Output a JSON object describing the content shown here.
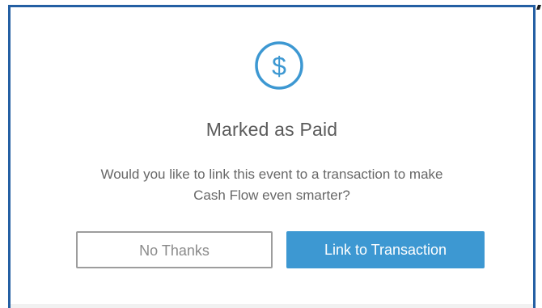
{
  "dialog": {
    "icon": "dollar-circle-icon",
    "icon_glyph": "$",
    "title": "Marked as Paid",
    "message": "Would you like to link this event to a transaction to make Cash Flow even smarter?",
    "secondary_button_label": "No Thanks",
    "primary_button_label": "Link to Transaction"
  },
  "colors": {
    "accent": "#3d98d2",
    "frame": "#245fa3",
    "text": "#5b5b5b",
    "secondary_border": "#9d9d9d"
  }
}
